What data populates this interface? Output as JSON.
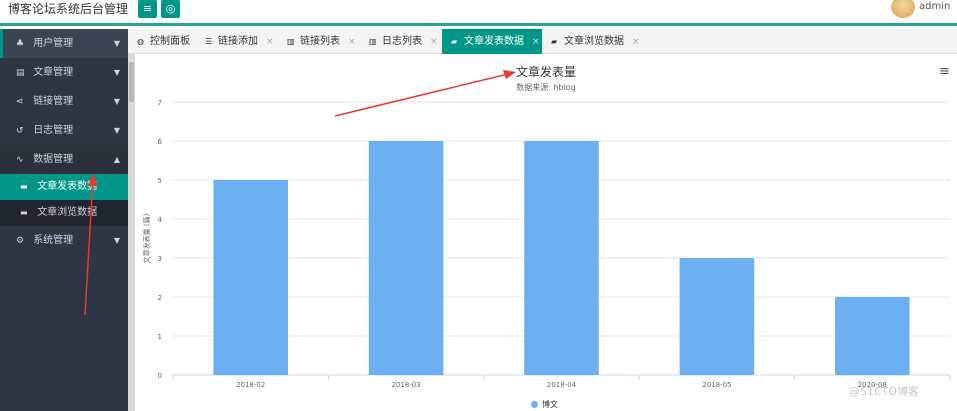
{
  "header": {
    "title": "博客论坛系统后台管理",
    "menu_icon": "≡",
    "refresh_icon": "◎",
    "user": "admin"
  },
  "sidebar": {
    "items": [
      {
        "label": "用户管理",
        "icon": "user-group-icon",
        "glyph": "♣",
        "caret": "▼"
      },
      {
        "label": "文章管理",
        "icon": "book-icon",
        "glyph": "▤",
        "caret": "▼"
      },
      {
        "label": "链接管理",
        "icon": "share-icon",
        "glyph": "⋖",
        "caret": "▼"
      },
      {
        "label": "日志管理",
        "icon": "history-icon",
        "glyph": "↺",
        "caret": "▼"
      },
      {
        "label": "数据管理",
        "icon": "pulse-icon",
        "glyph": "∿",
        "caret": "▲"
      }
    ],
    "subitems": [
      {
        "label": "文章发表数据",
        "glyph": "▬"
      },
      {
        "label": "文章浏览数据",
        "glyph": "▬"
      }
    ],
    "last_item": {
      "label": "系统管理",
      "glyph": "⚙",
      "caret": "▼"
    }
  },
  "tabs": [
    {
      "label": "控制面板",
      "glyph": "◍",
      "close": ""
    },
    {
      "label": "链接添加",
      "glyph": "☰",
      "close": "×"
    },
    {
      "label": "链接列表",
      "glyph": "▥",
      "close": "×"
    },
    {
      "label": "日志列表",
      "glyph": "▥",
      "close": "×"
    },
    {
      "label": "文章发表数据",
      "glyph": "▰",
      "close": "×"
    },
    {
      "label": "文章浏览数据",
      "glyph": "▰",
      "close": "×"
    }
  ],
  "chart_menu": "≡",
  "chart_data": {
    "type": "bar",
    "title": "文章发表量",
    "subtitle": "数据来源: hblog",
    "ylabel": "文章发表量 (篇)",
    "xlabel": "",
    "categories": [
      "2018-02",
      "2018-03",
      "2018-04",
      "2018-05",
      "2020-08"
    ],
    "series": [
      {
        "name": "博文",
        "values": [
          5,
          6,
          6,
          3,
          2
        ],
        "color": "#6db0f2"
      }
    ],
    "ylim": [
      0,
      7
    ],
    "yticks": [
      0,
      1,
      2,
      3,
      4,
      5,
      6,
      7
    ],
    "grid": true,
    "legend": "bottom"
  },
  "watermark": "@51CTO博客"
}
